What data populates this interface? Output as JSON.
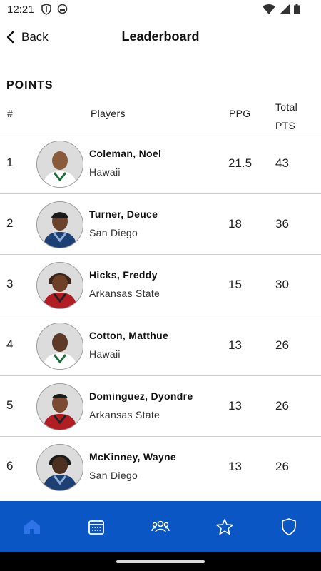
{
  "status_bar": {
    "time": "12:21"
  },
  "header": {
    "back_label": "Back",
    "title": "Leaderboard"
  },
  "section": {
    "title": "POINTS"
  },
  "table": {
    "columns": {
      "rank": "#",
      "players": "Players",
      "ppg": "PPG",
      "total": "Total PTS"
    },
    "rows": [
      {
        "rank": "1",
        "name": "Coleman, Noel",
        "team": "Hawaii",
        "ppg": "21.5",
        "total": "43"
      },
      {
        "rank": "2",
        "name": "Turner, Deuce",
        "team": "San Diego",
        "ppg": "18",
        "total": "36"
      },
      {
        "rank": "3",
        "name": "Hicks, Freddy",
        "team": "Arkansas State",
        "ppg": "15",
        "total": "30"
      },
      {
        "rank": "4",
        "name": "Cotton, Matthue",
        "team": "Hawaii",
        "ppg": "13",
        "total": "26"
      },
      {
        "rank": "5",
        "name": "Dominguez, Dyondre",
        "team": "Arkansas State",
        "ppg": "13",
        "total": "26"
      },
      {
        "rank": "6",
        "name": "McKinney, Wayne",
        "team": "San Diego",
        "ppg": "13",
        "total": "26"
      }
    ]
  },
  "bottom_nav": {
    "items": [
      {
        "icon": "home-icon",
        "active": true
      },
      {
        "icon": "calendar-icon",
        "active": false
      },
      {
        "icon": "people-icon",
        "active": false
      },
      {
        "icon": "star-icon",
        "active": false
      },
      {
        "icon": "shield-icon",
        "active": false
      }
    ]
  },
  "colors": {
    "nav_bg": "#0a56c4",
    "nav_icon": "#ffffff",
    "active_icon": "#2f73e8"
  }
}
